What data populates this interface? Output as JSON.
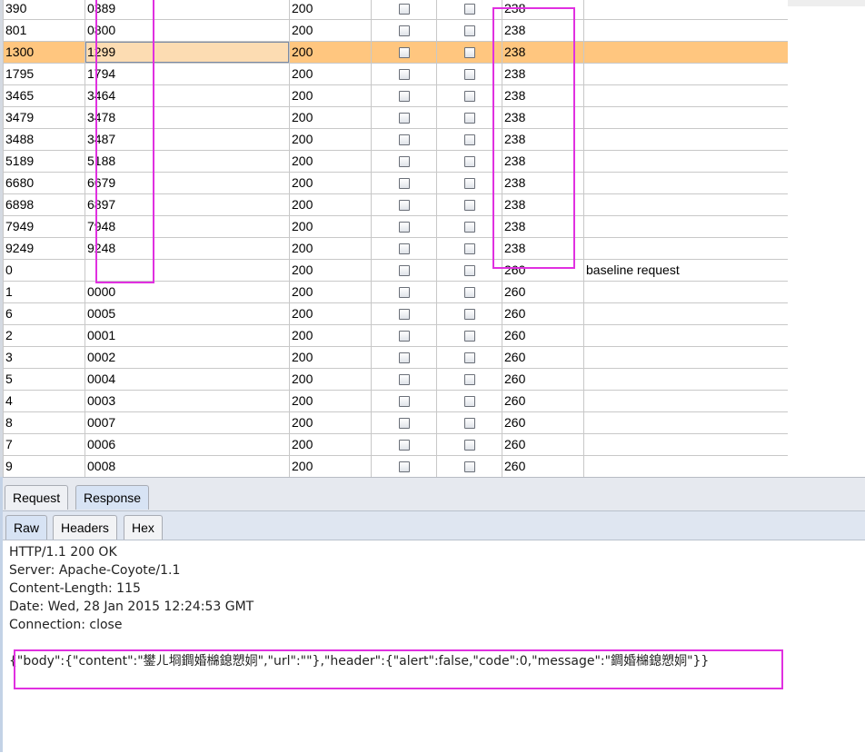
{
  "results_table": {
    "rows": [
      {
        "request": "390",
        "payload": "0389",
        "status": "200",
        "length": "238",
        "comment": ""
      },
      {
        "request": "801",
        "payload": "0800",
        "status": "200",
        "length": "238",
        "comment": ""
      },
      {
        "request": "1300",
        "payload": "1299",
        "status": "200",
        "length": "238",
        "comment": "",
        "selected": true
      },
      {
        "request": "1795",
        "payload": "1794",
        "status": "200",
        "length": "238",
        "comment": ""
      },
      {
        "request": "3465",
        "payload": "3464",
        "status": "200",
        "length": "238",
        "comment": ""
      },
      {
        "request": "3479",
        "payload": "3478",
        "status": "200",
        "length": "238",
        "comment": ""
      },
      {
        "request": "3488",
        "payload": "3487",
        "status": "200",
        "length": "238",
        "comment": ""
      },
      {
        "request": "5189",
        "payload": "5188",
        "status": "200",
        "length": "238",
        "comment": ""
      },
      {
        "request": "6680",
        "payload": "6679",
        "status": "200",
        "length": "238",
        "comment": ""
      },
      {
        "request": "6898",
        "payload": "6897",
        "status": "200",
        "length": "238",
        "comment": ""
      },
      {
        "request": "7949",
        "payload": "7948",
        "status": "200",
        "length": "238",
        "comment": ""
      },
      {
        "request": "9249",
        "payload": "9248",
        "status": "200",
        "length": "238",
        "comment": ""
      },
      {
        "request": "0",
        "payload": "",
        "status": "200",
        "length": "260",
        "comment": "baseline request"
      },
      {
        "request": "1",
        "payload": "0000",
        "status": "200",
        "length": "260",
        "comment": ""
      },
      {
        "request": "6",
        "payload": "0005",
        "status": "200",
        "length": "260",
        "comment": ""
      },
      {
        "request": "2",
        "payload": "0001",
        "status": "200",
        "length": "260",
        "comment": ""
      },
      {
        "request": "3",
        "payload": "0002",
        "status": "200",
        "length": "260",
        "comment": ""
      },
      {
        "request": "5",
        "payload": "0004",
        "status": "200",
        "length": "260",
        "comment": ""
      },
      {
        "request": "4",
        "payload": "0003",
        "status": "200",
        "length": "260",
        "comment": ""
      },
      {
        "request": "8",
        "payload": "0007",
        "status": "200",
        "length": "260",
        "comment": ""
      },
      {
        "request": "7",
        "payload": "0006",
        "status": "200",
        "length": "260",
        "comment": ""
      },
      {
        "request": "9",
        "payload": "0008",
        "status": "200",
        "length": "260",
        "comment": ""
      }
    ]
  },
  "tabs": {
    "request": "Request",
    "response": "Response"
  },
  "subtabs": {
    "raw": "Raw",
    "headers": "Headers",
    "hex": "Hex"
  },
  "response": {
    "lines": [
      "HTTP/1.1 200 OK",
      "Server: Apache-Coyote/1.1",
      "Content-Length: 115",
      "Date: Wed, 28 Jan 2015 12:24:53 GMT",
      "Connection: close"
    ],
    "body": "{\"body\":{\"content\":\"鐢ㄦ埛鐧婚檰鎴愬姛\",\"url\":\"\"},\"header\":{\"alert\":false,\"code\":0,\"message\":\"鐧婚檰鎴愬姛\"}}"
  },
  "colors": {
    "highlight": "#e030e0",
    "selected_row": "#ffc67f"
  }
}
